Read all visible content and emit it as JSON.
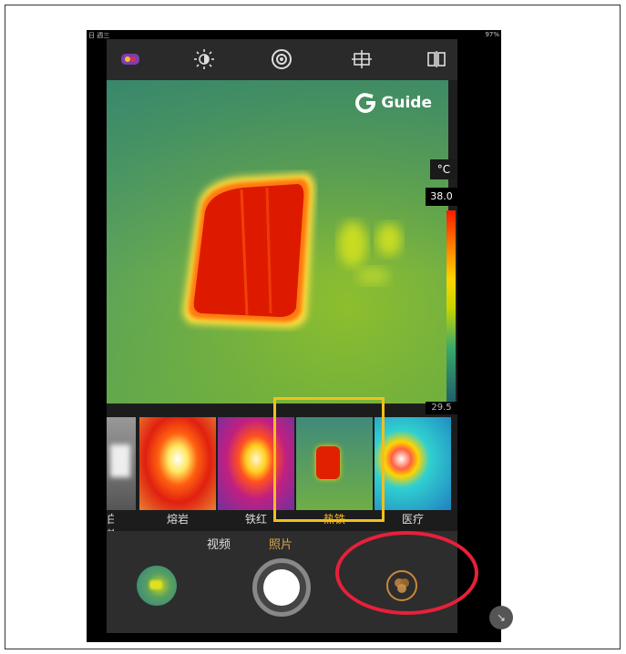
{
  "status_bar": {
    "left": "日 週三",
    "right": "97%"
  },
  "toolbar": {
    "icons": [
      "palette-icon",
      "brightness-icon",
      "camera-lens-icon",
      "crosshair-icon",
      "mirror-icon"
    ]
  },
  "viewfinder": {
    "brand": "Guide",
    "unit": "°C",
    "max_temp": "38.0",
    "min_temp": "29.5",
    "colors": {
      "hot": "#e02000",
      "warm": "#ffd400",
      "cool": "#3aa96a"
    }
  },
  "palettes": {
    "items": [
      {
        "label": "白热",
        "active": false
      },
      {
        "label": "熔岩",
        "active": false
      },
      {
        "label": "铁红",
        "active": false
      },
      {
        "label": "热铁",
        "active": true
      },
      {
        "label": "医疗",
        "active": false
      }
    ]
  },
  "modes": {
    "video": "视频",
    "photo": "照片",
    "active": "photo"
  },
  "annotations": {
    "highlight_color": "#f0c020",
    "circle_color": "#e8203a"
  }
}
